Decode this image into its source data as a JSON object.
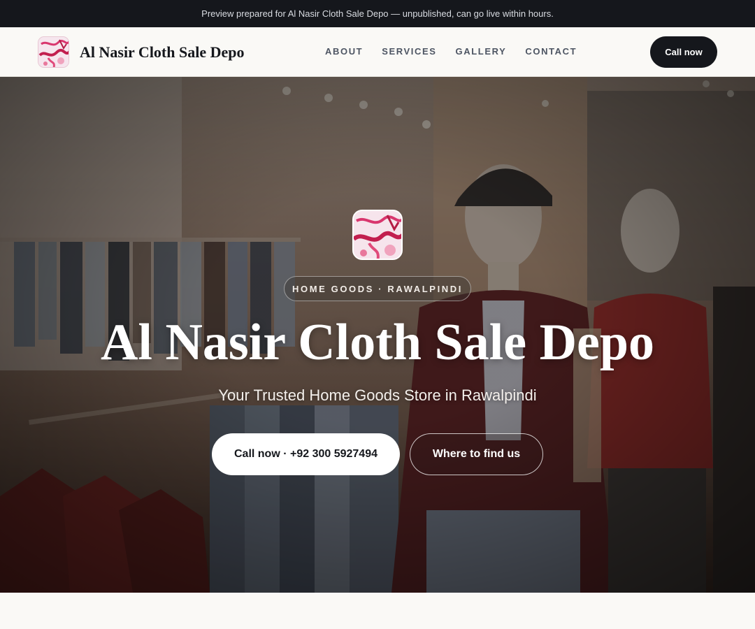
{
  "banner": {
    "text": "Preview prepared for Al Nasir Cloth Sale Depo — unpublished, can go live within hours."
  },
  "header": {
    "brand_name": "Al Nasir Cloth Sale Depo",
    "nav": [
      "ABOUT",
      "SERVICES",
      "GALLERY",
      "CONTACT"
    ],
    "call_label": "Call now"
  },
  "hero": {
    "tag": "HOME GOODS · RAWALPINDI",
    "title": "Al Nasir Cloth Sale Depo",
    "subtitle": "Your Trusted Home Goods Store in Rawalpindi",
    "primary_cta": "Call now · +92 300 5927494",
    "secondary_cta": "Where to find us"
  },
  "icons": {
    "brand_logo": "fabric-logo-icon"
  },
  "colors": {
    "dark": "#15171c",
    "nav_text": "#4d5563",
    "page_bg": "#faf9f6"
  }
}
